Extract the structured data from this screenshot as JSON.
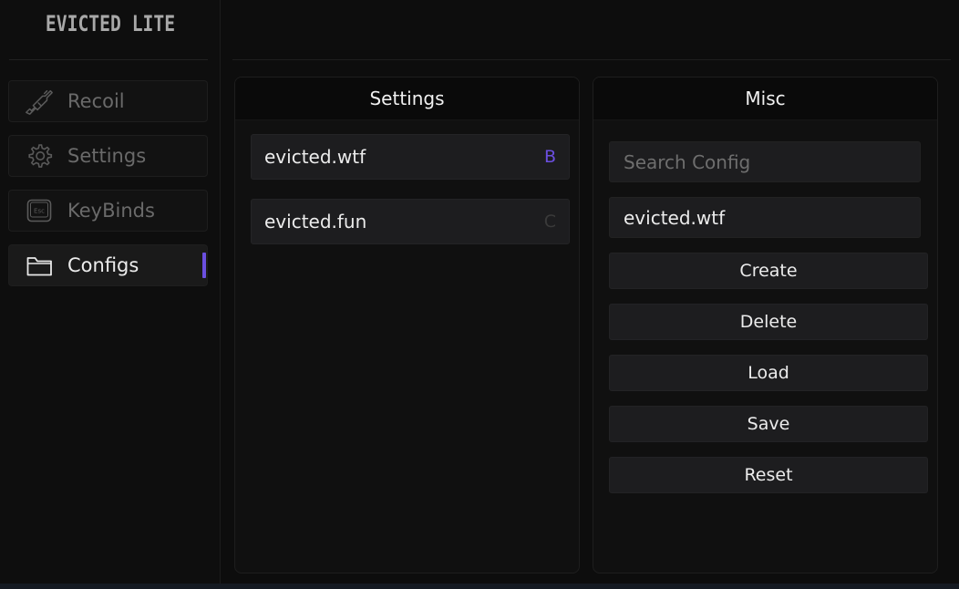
{
  "brand": "EVICTED LITE",
  "sidebar": {
    "items": [
      {
        "label": "Recoil",
        "icon": "rifle-icon"
      },
      {
        "label": "Settings",
        "icon": "gear-icon"
      },
      {
        "label": "KeyBinds",
        "icon": "esc-key-icon"
      },
      {
        "label": "Configs",
        "icon": "folder-icon",
        "active": true
      }
    ]
  },
  "settings_panel": {
    "title": "Settings",
    "configs": [
      {
        "name": "evicted.wtf",
        "key": "B",
        "key_color": "#6b4fe0"
      },
      {
        "name": "evicted.fun",
        "key": "C",
        "key_color": "#3a3a3a"
      }
    ]
  },
  "misc_panel": {
    "title": "Misc",
    "search_placeholder": "Search Config",
    "name_value": "evicted.wtf",
    "buttons": {
      "create": "Create",
      "delete": "Delete",
      "load": "Load",
      "save": "Save",
      "reset": "Reset"
    }
  },
  "colors": {
    "accent": "#6b4fe0",
    "background": "#0d0d0d",
    "panel": "#101010",
    "field": "#1d1d1f"
  }
}
